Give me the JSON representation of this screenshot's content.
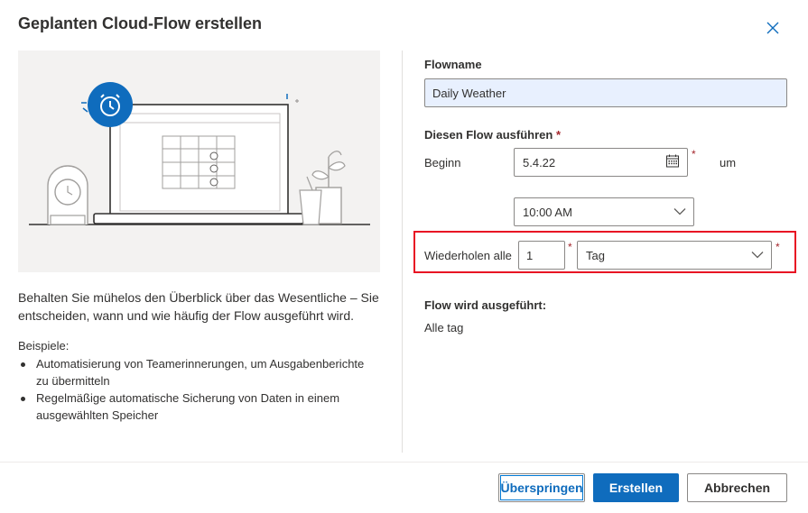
{
  "dialog": {
    "title": "Geplanten Cloud-Flow erstellen",
    "close_icon": "close-icon"
  },
  "left": {
    "description": "Behalten Sie mühelos den Überblick über das Wesentliche – Sie entscheiden, wann und wie häufig der Flow ausgeführt wird.",
    "examples_label": "Beispiele:",
    "examples": [
      "Automatisierung von Teamerinnerungen, um Ausgabenberichte zu übermitteln",
      "Regelmäßige automatische Sicherung von Daten in einem ausgewählten Speicher"
    ]
  },
  "form": {
    "flowname_label": "Flowname",
    "flowname_value": "Daily Weather",
    "run_label": "Diesen Flow ausführen",
    "required_mark": "*",
    "start_label": "Beginn",
    "start_date": "5.4.22",
    "at_label": "um",
    "start_time": "10:00 AM",
    "repeat_label": "Wiederholen alle",
    "repeat_interval": "1",
    "repeat_unit": "Tag",
    "runs_label": "Flow wird ausgeführt:",
    "runs_value": "Alle tag"
  },
  "footer": {
    "skip_label": "Überspringen",
    "create_label": "Erstellen",
    "cancel_label": "Abbrechen"
  },
  "colors": {
    "primary": "#0f6cbd",
    "highlight": "#e81123",
    "required": "#a4262c"
  }
}
